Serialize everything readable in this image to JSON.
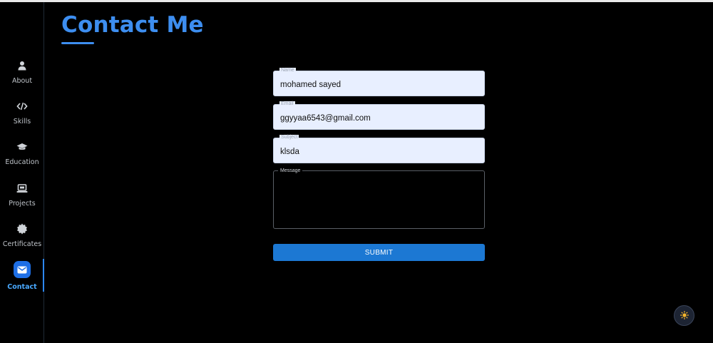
{
  "page": {
    "title": "Contact Me"
  },
  "sidebar": {
    "items": [
      {
        "label": "About",
        "icon": "person-icon"
      },
      {
        "label": "Skills",
        "icon": "code-icon"
      },
      {
        "label": "Education",
        "icon": "graduation-cap-icon"
      },
      {
        "label": "Projects",
        "icon": "laptop-icon"
      },
      {
        "label": "Certificates",
        "icon": "certificate-badge-icon"
      },
      {
        "label": "Contact",
        "icon": "envelope-icon",
        "active": true
      }
    ]
  },
  "form": {
    "name": {
      "label": "Name",
      "value": "mohamed sayed"
    },
    "email": {
      "label": "Email",
      "value": "ggyyaa6543@gmail.com"
    },
    "subject": {
      "label": "Subject",
      "value": "klsda"
    },
    "message": {
      "label": "Message",
      "value": ""
    },
    "submit_label": "SUBMIT"
  },
  "theme_toggle": {
    "icon": "sun-icon"
  },
  "colors": {
    "accent": "#3d8ef0",
    "button": "#1c78d3",
    "active_nav": "#1e6fe6",
    "background": "#000000"
  }
}
